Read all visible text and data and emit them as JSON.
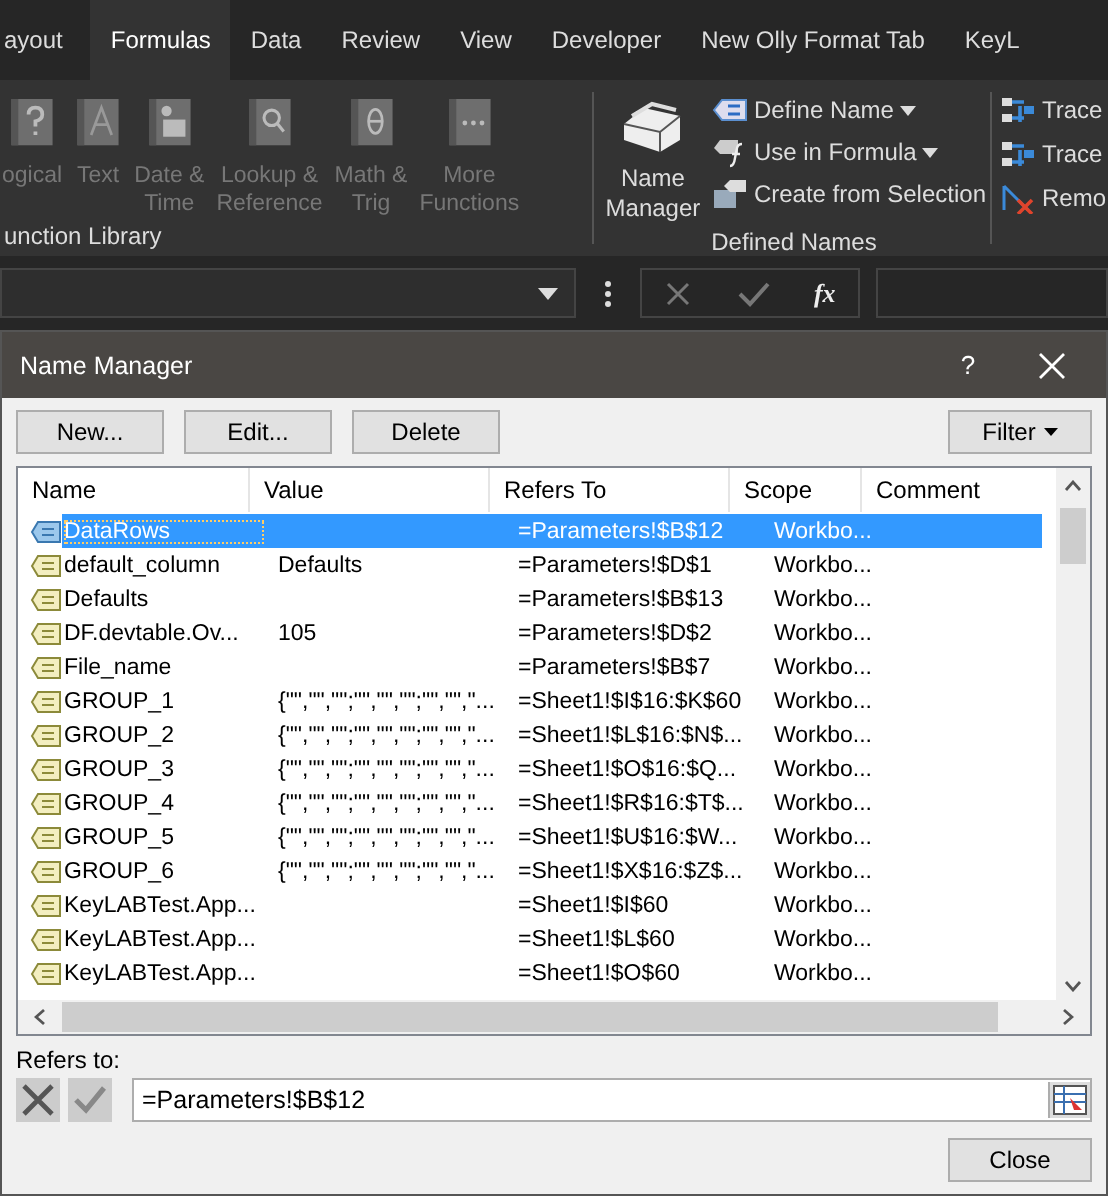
{
  "ribbon": {
    "tabs": [
      {
        "label": "ayout",
        "selected": false
      },
      {
        "label": "Formulas",
        "selected": true
      },
      {
        "label": "Data",
        "selected": false
      },
      {
        "label": "Review",
        "selected": false
      },
      {
        "label": "View",
        "selected": false
      },
      {
        "label": "Developer",
        "selected": false
      },
      {
        "label": "New Olly Format Tab",
        "selected": false
      },
      {
        "label": "KeyL",
        "selected": false
      }
    ],
    "function_library": {
      "label": "unction Library",
      "buttons": [
        {
          "kind": "logical",
          "lines": [
            "ogical"
          ],
          "disabled": true
        },
        {
          "kind": "text",
          "lines": [
            "Text"
          ],
          "disabled": true
        },
        {
          "kind": "date",
          "lines": [
            "Date &",
            "Time"
          ],
          "disabled": true
        },
        {
          "kind": "lookup",
          "lines": [
            "Lookup &",
            "Reference"
          ],
          "disabled": true
        },
        {
          "kind": "math",
          "lines": [
            "Math &",
            "Trig"
          ],
          "disabled": true
        },
        {
          "kind": "more",
          "lines": [
            "More",
            "Functions"
          ],
          "disabled": true
        }
      ]
    },
    "defined_names": {
      "label": "Defined Names",
      "name_manager": "Name Manager",
      "commands": [
        {
          "kind": "define",
          "label": "Define Name",
          "dropdown": true
        },
        {
          "kind": "use",
          "label": "Use in Formula",
          "dropdown": true
        },
        {
          "kind": "create",
          "label": "Create from Selection",
          "dropdown": false
        }
      ]
    },
    "auditing": [
      {
        "kind": "precedents",
        "label": "Trace"
      },
      {
        "kind": "dependents",
        "label": "Trace"
      },
      {
        "kind": "remove",
        "label": "Remo"
      }
    ]
  },
  "formula_bar": {
    "fx": "fx"
  },
  "dialog": {
    "title": "Name Manager",
    "help": "?",
    "buttons": [
      "New...",
      "Edit...",
      "Delete"
    ],
    "filter": "Filter",
    "columns": [
      "Name",
      "Value",
      "Refers To",
      "Scope",
      "Comment"
    ],
    "rows": [
      {
        "name": "DataRows",
        "value": "",
        "refers_to": "=Parameters!$B$12",
        "scope": "Workbo...",
        "selected": true
      },
      {
        "name": "default_column",
        "value": "Defaults",
        "refers_to": "=Parameters!$D$1",
        "scope": "Workbo...",
        "selected": false
      },
      {
        "name": "Defaults",
        "value": "",
        "refers_to": "=Parameters!$B$13",
        "scope": "Workbo...",
        "selected": false
      },
      {
        "name": "DF.devtable.Ov...",
        "value": "105",
        "refers_to": "=Parameters!$D$2",
        "scope": "Workbo...",
        "selected": false
      },
      {
        "name": "File_name",
        "value": "",
        "refers_to": "=Parameters!$B$7",
        "scope": "Workbo...",
        "selected": false
      },
      {
        "name": "GROUP_1",
        "value": "{\"\",\"\",\"\";\"\",\"\",\"\";\"\",\"\",\"...",
        "refers_to": "=Sheet1!$I$16:$K$60",
        "scope": "Workbo...",
        "selected": false
      },
      {
        "name": "GROUP_2",
        "value": "{\"\",\"\",\"\";\"\",\"\",\"\";\"\",\"\",\"...",
        "refers_to": "=Sheet1!$L$16:$N$...",
        "scope": "Workbo...",
        "selected": false
      },
      {
        "name": "GROUP_3",
        "value": "{\"\",\"\",\"\";\"\",\"\",\"\";\"\",\"\",\"...",
        "refers_to": "=Sheet1!$O$16:$Q...",
        "scope": "Workbo...",
        "selected": false
      },
      {
        "name": "GROUP_4",
        "value": "{\"\",\"\",\"\";\"\",\"\",\"\";\"\",\"\",\"...",
        "refers_to": "=Sheet1!$R$16:$T$...",
        "scope": "Workbo...",
        "selected": false
      },
      {
        "name": "GROUP_5",
        "value": "{\"\",\"\",\"\";\"\",\"\",\"\";\"\",\"\",\"...",
        "refers_to": "=Sheet1!$U$16:$W...",
        "scope": "Workbo...",
        "selected": false
      },
      {
        "name": "GROUP_6",
        "value": "{\"\",\"\",\"\";\"\",\"\",\"\";\"\",\"\",\"...",
        "refers_to": "=Sheet1!$X$16:$Z$...",
        "scope": "Workbo...",
        "selected": false
      },
      {
        "name": "KeyLABTest.App...",
        "value": "",
        "refers_to": "=Sheet1!$I$60",
        "scope": "Workbo...",
        "selected": false
      },
      {
        "name": "KeyLABTest.App...",
        "value": "",
        "refers_to": "=Sheet1!$L$60",
        "scope": "Workbo...",
        "selected": false
      },
      {
        "name": "KeyLABTest.App...",
        "value": "",
        "refers_to": "=Sheet1!$O$60",
        "scope": "Workbo...",
        "selected": false
      }
    ],
    "refers_to_label": "Refers to:",
    "refers_to_value": "=Parameters!$B$12",
    "close": "Close"
  }
}
